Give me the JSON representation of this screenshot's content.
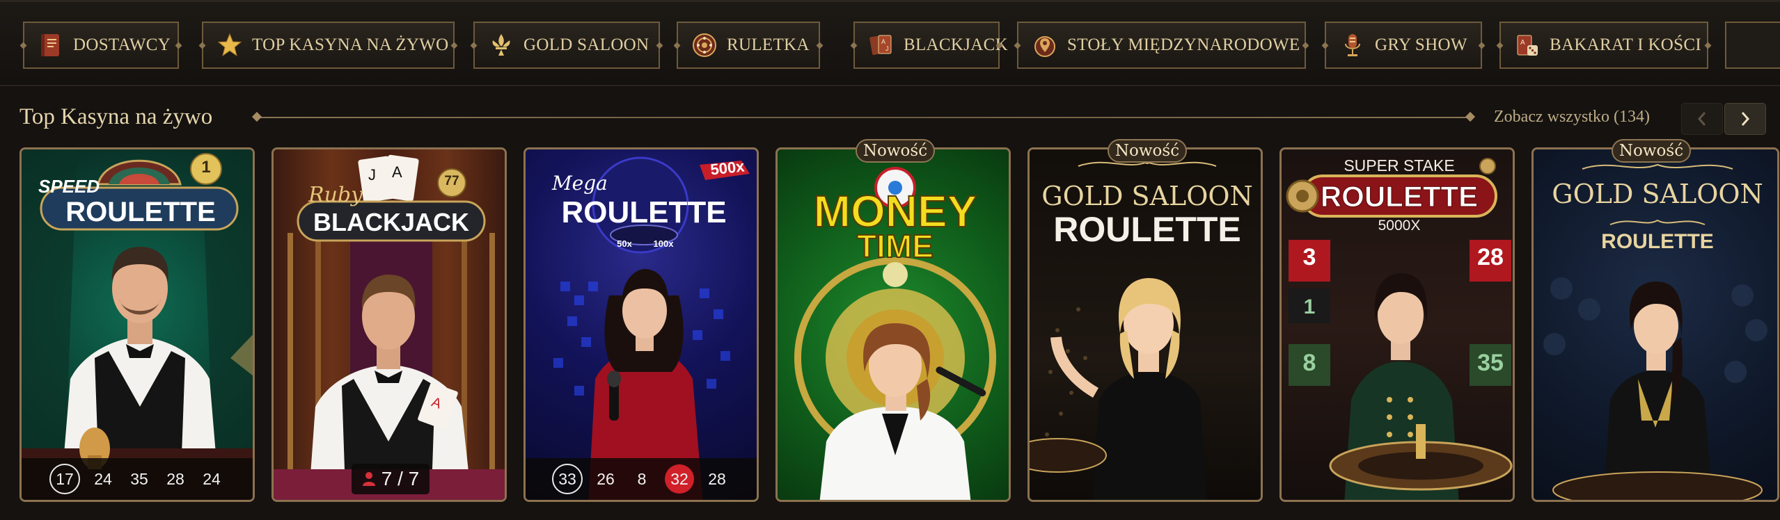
{
  "categories": [
    {
      "label": "DOSTAWCY",
      "icon": "book-icon"
    },
    {
      "label": "TOP KASYNA NA ŻYWO",
      "icon": "star-icon"
    },
    {
      "label": "GOLD SALOON",
      "icon": "fleur-de-lis-icon"
    },
    {
      "label": "RULETKA",
      "icon": "roulette-wheel-icon"
    },
    {
      "label": "BLACKJACK",
      "icon": "playing-cards-icon"
    },
    {
      "label": "STOŁY MIĘDZYNARODOWE",
      "icon": "globe-pin-icon"
    },
    {
      "label": "GRY SHOW",
      "icon": "microphone-icon"
    },
    {
      "label": "BAKARAT I KOŚCI",
      "icon": "cards-dice-icon"
    }
  ],
  "section": {
    "title": "Top Kasyna na żywo",
    "see_all": "Zobacz wszystko (134)"
  },
  "tiles": [
    {
      "logo_small": "SPEED",
      "logo_main": "ROULETTE",
      "corner_badge": "1",
      "results": [
        "17",
        "24",
        "35",
        "28",
        "24"
      ]
    },
    {
      "logo_small": "Ruby",
      "logo_main": "BLACKJACK",
      "corner_badge": "77",
      "seats": "7 / 7"
    },
    {
      "logo_small": "Mega",
      "logo_main": "ROULETTE",
      "multiplier": "500x",
      "chips": [
        "50x",
        "100x"
      ],
      "results": [
        "33",
        "26",
        "8",
        "32",
        "28"
      ]
    },
    {
      "badge": "Nowość",
      "logo_line1": "MONEY",
      "logo_line2": "TIME"
    },
    {
      "badge": "Nowość",
      "logo_line1": "GOLD SALOON",
      "logo_line2": "ROULETTE"
    },
    {
      "logo_top": "SUPER STAKE",
      "logo_main": "ROULETTE",
      "logo_sub": "5000X",
      "board_numbers": [
        "3",
        "1",
        "28",
        "8",
        "35"
      ]
    },
    {
      "badge": "Nowość",
      "logo_line1": "GOLD SALOON",
      "logo_line2": "ROULETTE"
    }
  ],
  "colors": {
    "gold": "#d9c79a",
    "border_gold": "#8c7250",
    "red_result": "#d0202a",
    "background": "#151210"
  }
}
